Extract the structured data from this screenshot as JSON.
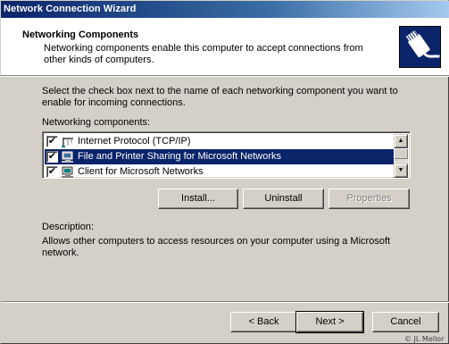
{
  "window": {
    "title": "Network Connection Wizard"
  },
  "header": {
    "title": "Networking Components",
    "subtitle": "Networking components enable this computer to accept connections from other kinds of computers.",
    "icon": "network-cable-plug-icon"
  },
  "instructions": "Select the check box next to the name of each networking component you want to enable for incoming connections.",
  "components": {
    "label": "Networking components:",
    "items": [
      {
        "label": "Internet Protocol (TCP/IP)",
        "checked": true,
        "selected": false,
        "icon": "protocol-icon"
      },
      {
        "label": "File and Printer Sharing for Microsoft Networks",
        "checked": true,
        "selected": true,
        "icon": "service-computer-icon"
      },
      {
        "label": "Client for Microsoft Networks",
        "checked": true,
        "selected": false,
        "icon": "client-computer-icon"
      }
    ]
  },
  "actions": {
    "install": "Install...",
    "uninstall": "Uninstall",
    "properties": "Properties"
  },
  "description": {
    "label": "Description:",
    "text": "Allows other computers to access resources on your computer using a Microsoft network."
  },
  "nav": {
    "back": "< Back",
    "next": "Next >",
    "cancel": "Cancel"
  },
  "credit": "© JL Mellor",
  "colors": {
    "title_bar": "#0a246a",
    "selection": "#0a246a",
    "face": "#d4d0c8"
  }
}
